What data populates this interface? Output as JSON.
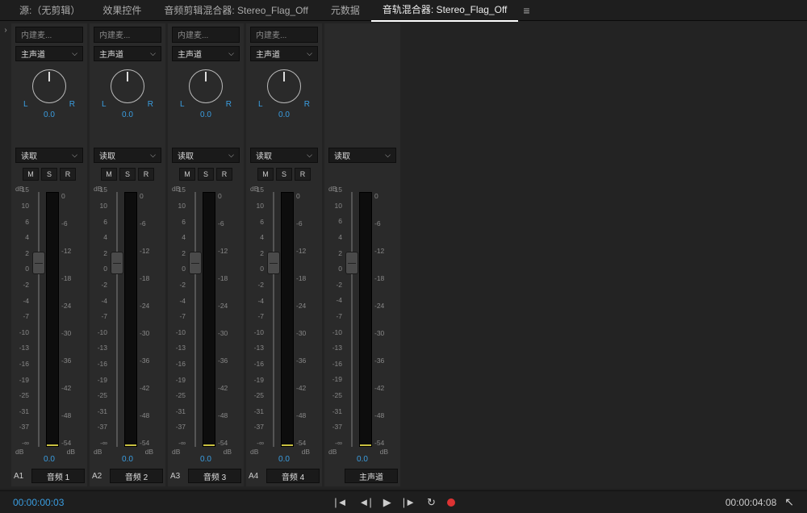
{
  "tabs": [
    {
      "label": "源:（无剪辑）"
    },
    {
      "label": "效果控件"
    },
    {
      "label": "音频剪辑混合器: Stereo_Flag_Off"
    },
    {
      "label": "元数据"
    },
    {
      "label": "音轨混合器: Stereo_Flag_Off",
      "active": true
    }
  ],
  "common": {
    "output_label": "主声道",
    "mode_label": "读取",
    "L": "L",
    "R": "R",
    "M": "M",
    "S": "S",
    "Rbtn": "R",
    "dB": "dB"
  },
  "left_scale": [
    "15",
    "10",
    "6",
    "4",
    "2",
    "0",
    "-2",
    "-4",
    "-7",
    "-10",
    "-13",
    "-16",
    "-19",
    "-25",
    "-31",
    "-37",
    "-∞"
  ],
  "right_scale": [
    "0",
    "-6",
    "-12",
    "-18",
    "-24",
    "-30",
    "-36",
    "-42",
    "-48",
    "-54"
  ],
  "tracks": [
    {
      "input": "内建麦...",
      "pan": "0.0",
      "vol": "0.0",
      "id": "A1",
      "name": "音频 1"
    },
    {
      "input": "内建麦...",
      "pan": "0.0",
      "vol": "0.0",
      "id": "A2",
      "name": "音频 2"
    },
    {
      "input": "内建麦...",
      "pan": "0.0",
      "vol": "0.0",
      "id": "A3",
      "name": "音频 3"
    },
    {
      "input": "内建麦...",
      "pan": "0.0",
      "vol": "0.0",
      "id": "A4",
      "name": "音频 4"
    }
  ],
  "master": {
    "vol": "0.0",
    "name": "主声道"
  },
  "footer": {
    "tc_left": "00:00:00:03",
    "tc_right": "00:00:04:08"
  }
}
